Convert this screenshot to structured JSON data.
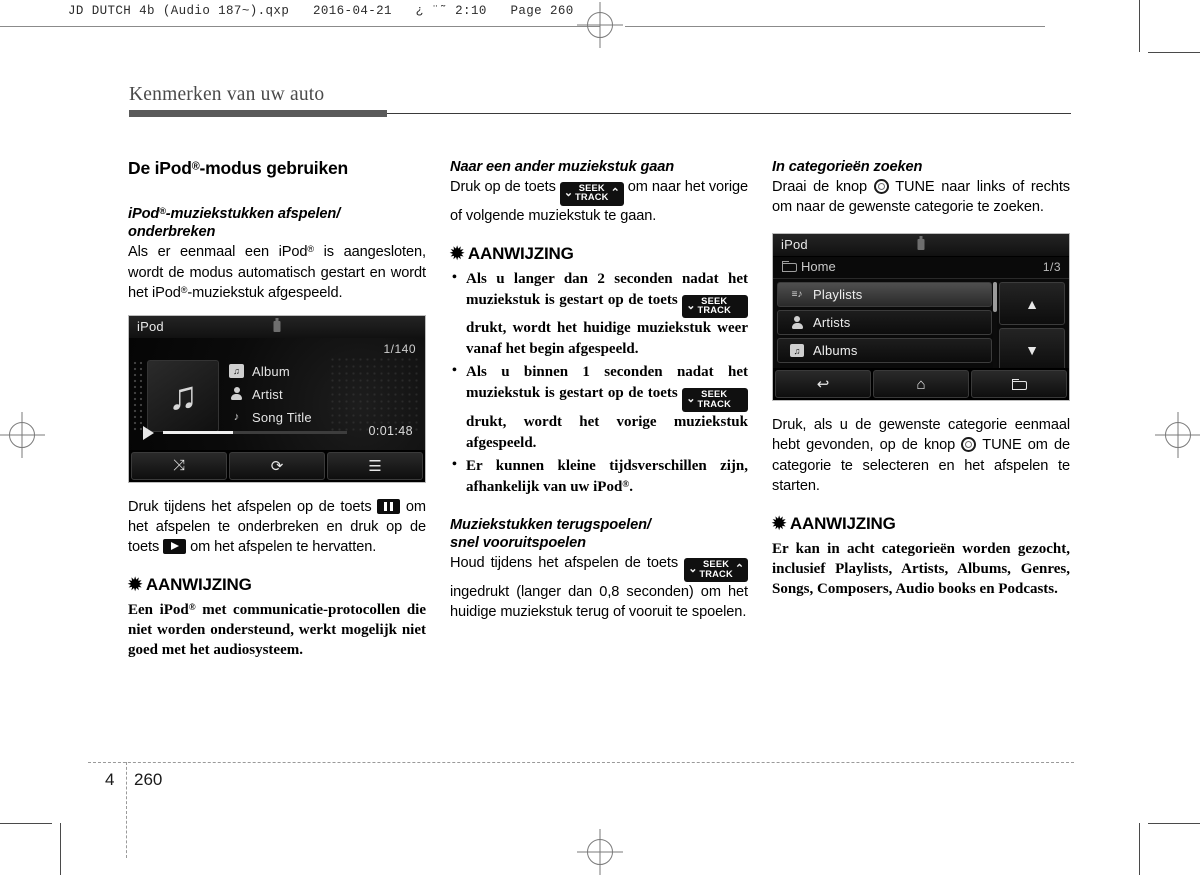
{
  "print_header": {
    "text": "JD DUTCH 4b (Audio 187~).qxp   2016-04-21   ¿ ¨˜ 2:10   Page 260"
  },
  "running_head": {
    "title": "Kenmerken van uw auto"
  },
  "footer": {
    "chapter": "4",
    "page": "260"
  },
  "column1": {
    "section_title_a": "De iPod",
    "section_title_b": "-modus gebruiken",
    "sub1_line1": "iPod",
    "sub1_line1b": "-muziekstukken afspelen/",
    "sub1_line2": "onderbreken",
    "para1_a": "Als er eenmaal een iPod",
    "para1_b": " is aangesloten, wordt de modus automatisch gestart en wordt het iPod",
    "para1_c": "-muziekstuk afgespeeld.",
    "para2_a": "Druk tijdens het afspelen op de toets",
    "para2_b": "om het afspelen te onderbreken en druk op de toets",
    "para2_c": "om het afspelen te hervatten.",
    "notice_title": "✹ AANWIJZING",
    "notice_a": "Een iPod",
    "notice_b": " met communicatie-protocollen die niet worden ondersteund, werkt mogelijk niet goed met het audiosysteem.",
    "player_screen": {
      "header_label": "iPod",
      "usb_icon": "usb-device-icon",
      "track_count": "1/140",
      "album_art_icon": "music-note-icon",
      "rows": [
        {
          "icon": "album-icon",
          "glyph": "♫",
          "label": "Album"
        },
        {
          "icon": "artist-icon",
          "glyph": "",
          "label": "Artist"
        },
        {
          "icon": "song-icon",
          "glyph": "♪",
          "label": "Song Title"
        }
      ],
      "play_icon": "play-icon",
      "elapsed_time": "0:01:48",
      "progress_percent": 38,
      "bottom_buttons": [
        {
          "icon": "shuffle-icon",
          "glyph": "⤨"
        },
        {
          "icon": "repeat-icon",
          "glyph": "⟳"
        },
        {
          "icon": "list-menu-icon",
          "glyph": "☰"
        }
      ]
    }
  },
  "column2": {
    "sub1": "Naar een ander muziekstuk gaan",
    "para1_a": "Druk op de toets",
    "para1_b": "om naar het vorige of volgende muziekstuk te gaan.",
    "notice_title": "✹ AANWIJZING",
    "bullets": [
      {
        "a": "Als u langer dan 2 seconden nadat het muziekstuk is gestart op de toets",
        "b": "drukt, wordt het huidige muziekstuk weer vanaf het begin afgespeeld."
      },
      {
        "a": "Als u binnen 1 seconden nadat het muziekstuk is gestart op de toets",
        "b": "drukt, wordt het vorige muziekstuk afgespeeld."
      }
    ],
    "bullet3_a": "Er kunnen kleine tijdsverschillen zijn, afhankelijk van uw iPod",
    "bullet3_b": ".",
    "sub2_line1": "Muziekstukken terugspoelen/",
    "sub2_line2": "snel vooruitspoelen",
    "para2_a": "Houd tijdens het afspelen de toets",
    "para2_b": "ingedrukt (langer dan 0,8 seconden) om het huidige muziekstuk terug of vooruit te spoelen.",
    "seek_key": {
      "top": "SEEK",
      "bottom": "TRACK",
      "chevron_left": "⌄",
      "chevron_right": "⌃"
    }
  },
  "column3": {
    "sub1": "In categorieën zoeken",
    "para1_a": "Draai de knop",
    "para1_b": "TUNE naar links of rechts om naar de gewenste categorie te zoeken.",
    "para2_a": "Druk, als u de gewenste categorie eenmaal hebt gevonden, op de knop",
    "para2_b": "TUNE om de categorie te selecteren en het afspelen te starten.",
    "notice_title": "✹ AANWIJZING",
    "notice_body": "Er kan in acht categorieën worden gezocht, inclusief Playlists, Artists, Albums, Genres, Songs, Composers, Audio books en Podcasts.",
    "list_screen": {
      "header_label": "iPod",
      "usb_icon": "usb-device-icon",
      "breadcrumb_icon": "folder-icon",
      "breadcrumb": "Home",
      "page_indicator": "1/3",
      "items": [
        {
          "icon": "playlist-icon",
          "glyph": "≡♪",
          "label": "Playlists",
          "selected": true
        },
        {
          "icon": "artist-icon",
          "glyph": "",
          "label": "Artists",
          "selected": false
        },
        {
          "icon": "album-icon",
          "glyph": "♫",
          "label": "Albums",
          "selected": false
        }
      ],
      "scroll_up_icon": "▲",
      "scroll_down_icon": "▼",
      "bottom_buttons": [
        {
          "icon": "back-arrow-icon",
          "glyph": "↩"
        },
        {
          "icon": "home-icon",
          "glyph": "⌂"
        },
        {
          "icon": "folder-up-icon",
          "glyph": ""
        }
      ]
    }
  }
}
